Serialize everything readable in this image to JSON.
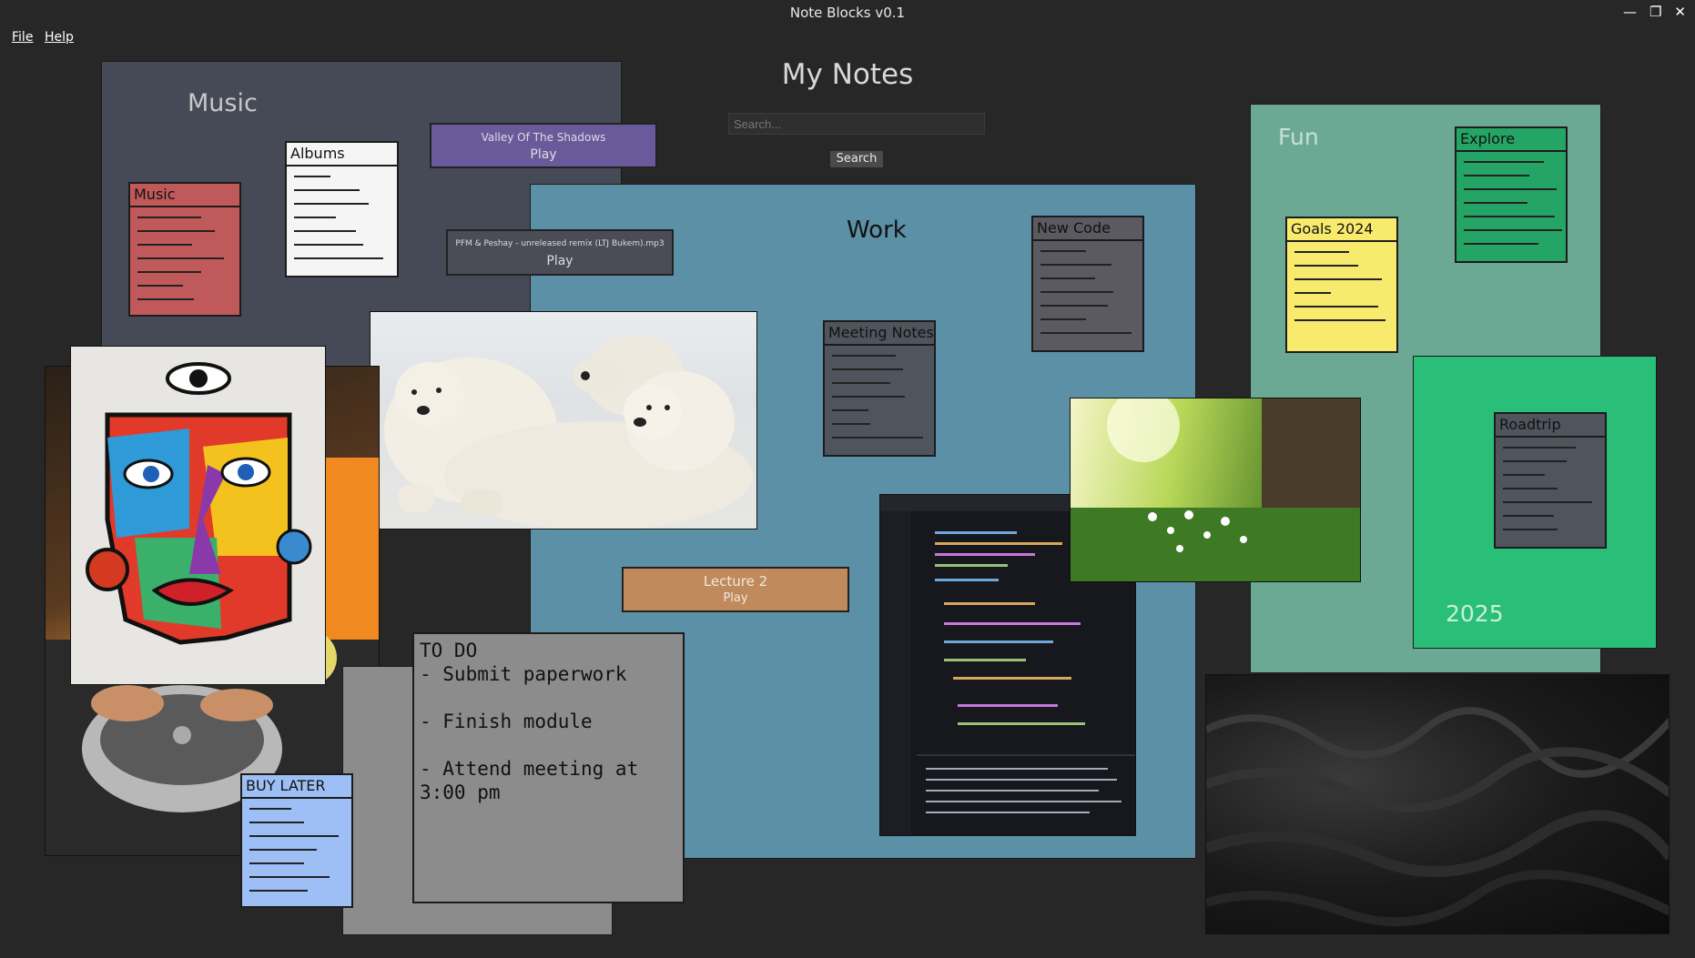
{
  "window": {
    "title": "Note Blocks v0.1",
    "minimize_icon": "minimize-icon",
    "maximize_icon": "maximize-icon",
    "close_icon": "close-icon"
  },
  "menu": {
    "file": "File",
    "help": "Help"
  },
  "header": {
    "title": "My Notes",
    "search_placeholder": "Search...",
    "search_button": "Search"
  },
  "boards": {
    "music": {
      "label": "Music",
      "color": "#464a56"
    },
    "work": {
      "label": "Work",
      "color": "#5c90a6"
    },
    "fun": {
      "label": "Fun",
      "color": "#6ba995"
    },
    "year": {
      "label": "2025",
      "color": "#2abf79"
    }
  },
  "notes": {
    "music": {
      "title": "Music",
      "color": "#c05a5a"
    },
    "albums": {
      "title": "Albums",
      "color": "#f5f5f5"
    },
    "new_code": {
      "title": "New Code",
      "color": "#5a5a60"
    },
    "meeting_notes": {
      "title": "Meeting Notes",
      "color": "#4f545d"
    },
    "goals": {
      "title": "Goals 2024",
      "color": "#f8ea6c"
    },
    "explore": {
      "title": "Explore",
      "color": "#24a565"
    },
    "roadtrip": {
      "title": "Roadtrip",
      "color": "#4f545d"
    },
    "buy_later": {
      "title": "BUY LATER",
      "color": "#9dbff5"
    }
  },
  "players": {
    "valley": {
      "title": "Valley Of The Shadows",
      "action": "Play",
      "color": "#6a5a9c"
    },
    "pfm": {
      "title": "PFM & Peshay - unreleased remix (LTJ Bukem).mp3",
      "action": "Play",
      "color": "#4a4d55"
    },
    "lecture": {
      "title": "Lecture 2",
      "action": "Play",
      "color": "#c08a5c"
    }
  },
  "todo": {
    "text": "TO DO\n- Submit paperwork\n\n- Finish module\n\n- Attend meeting at\n3:00 pm"
  }
}
